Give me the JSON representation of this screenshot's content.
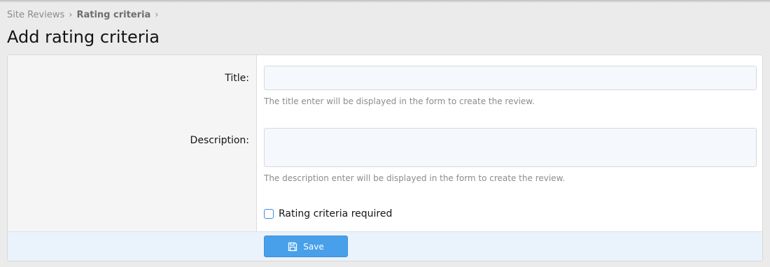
{
  "breadcrumb": {
    "items": [
      {
        "label": "Site Reviews"
      },
      {
        "label": "Rating criteria"
      }
    ],
    "separator": "›"
  },
  "page": {
    "title": "Add rating criteria"
  },
  "form": {
    "title_field": {
      "label": "Title:",
      "value": "",
      "hint": "The title enter will be displayed in the form to create the review."
    },
    "description_field": {
      "label": "Description:",
      "value": "",
      "hint": "The description enter will be displayed in the form to create the review."
    },
    "required_checkbox": {
      "label": "Rating criteria required",
      "checked": false
    },
    "save_button": {
      "label": "Save",
      "icon": "save-icon"
    }
  },
  "colors": {
    "accent": "#48a0ea",
    "background": "#ebebeb",
    "footer": "#eaf3fb"
  }
}
